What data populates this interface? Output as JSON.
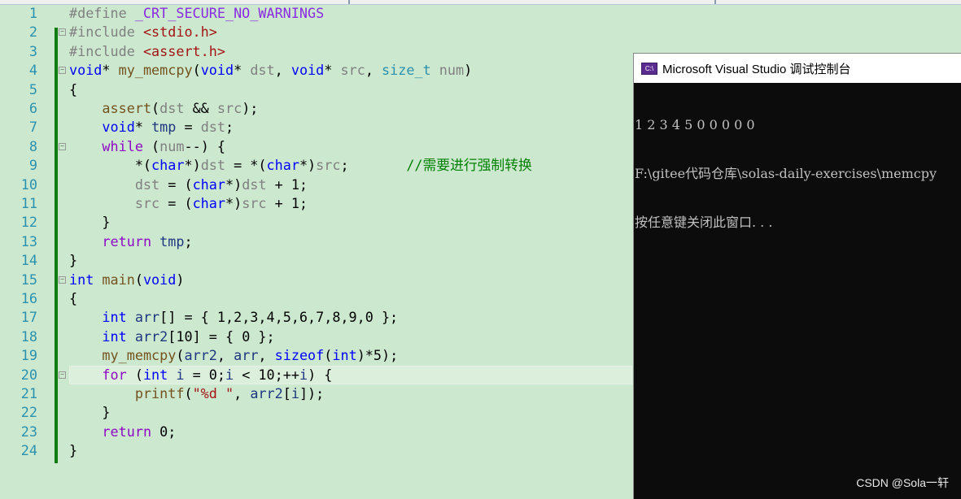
{
  "editor": {
    "current_line": 20,
    "lines": [
      [
        [
          "pp",
          "#define "
        ],
        [
          "mac",
          "_CRT_SECURE_NO_WARNINGS"
        ]
      ],
      [
        [
          "pp",
          "#include "
        ],
        [
          "str",
          "<stdio.h>"
        ]
      ],
      [
        [
          "pp",
          "#include "
        ],
        [
          "str",
          "<assert.h>"
        ]
      ],
      [
        [
          "kw",
          "void"
        ],
        [
          "pl",
          "* "
        ],
        [
          "fn",
          "my_memcpy"
        ],
        [
          "pl",
          "("
        ],
        [
          "kw",
          "void"
        ],
        [
          "pl",
          "* "
        ],
        [
          "par",
          "dst"
        ],
        [
          "pl",
          ", "
        ],
        [
          "kw",
          "void"
        ],
        [
          "pl",
          "* "
        ],
        [
          "par",
          "src"
        ],
        [
          "pl",
          ", "
        ],
        [
          "ty",
          "size_t"
        ],
        [
          "pl",
          " "
        ],
        [
          "par",
          "num"
        ],
        [
          "pl",
          ")"
        ]
      ],
      [
        [
          "pl",
          "{"
        ]
      ],
      [
        [
          "pl",
          "    "
        ],
        [
          "fn",
          "assert"
        ],
        [
          "pl",
          "("
        ],
        [
          "par",
          "dst"
        ],
        [
          "pl",
          " && "
        ],
        [
          "par",
          "src"
        ],
        [
          "pl",
          ");"
        ]
      ],
      [
        [
          "pl",
          "    "
        ],
        [
          "kw",
          "void"
        ],
        [
          "pl",
          "* "
        ],
        [
          "loc",
          "tmp"
        ],
        [
          "pl",
          " = "
        ],
        [
          "par",
          "dst"
        ],
        [
          "pl",
          ";"
        ]
      ],
      [
        [
          "pl",
          "    "
        ],
        [
          "ctl",
          "while"
        ],
        [
          "pl",
          " ("
        ],
        [
          "par",
          "num"
        ],
        [
          "pl",
          "--) {"
        ]
      ],
      [
        [
          "pl",
          "        *("
        ],
        [
          "kw",
          "char"
        ],
        [
          "pl",
          "*)"
        ],
        [
          "par",
          "dst"
        ],
        [
          "pl",
          " = *("
        ],
        [
          "kw",
          "char"
        ],
        [
          "pl",
          "*)"
        ],
        [
          "par",
          "src"
        ],
        [
          "pl",
          ";       "
        ],
        [
          "cmt",
          "//需要进行强制转换"
        ]
      ],
      [
        [
          "pl",
          "        "
        ],
        [
          "par",
          "dst"
        ],
        [
          "pl",
          " = ("
        ],
        [
          "kw",
          "char"
        ],
        [
          "pl",
          "*)"
        ],
        [
          "par",
          "dst"
        ],
        [
          "pl",
          " + 1;"
        ]
      ],
      [
        [
          "pl",
          "        "
        ],
        [
          "par",
          "src"
        ],
        [
          "pl",
          " = ("
        ],
        [
          "kw",
          "char"
        ],
        [
          "pl",
          "*)"
        ],
        [
          "par",
          "src"
        ],
        [
          "pl",
          " + 1;"
        ]
      ],
      [
        [
          "pl",
          "    }"
        ]
      ],
      [
        [
          "pl",
          "    "
        ],
        [
          "ctl",
          "return"
        ],
        [
          "pl",
          " "
        ],
        [
          "loc",
          "tmp"
        ],
        [
          "pl",
          ";"
        ]
      ],
      [
        [
          "pl",
          "}"
        ]
      ],
      [
        [
          "kw",
          "int"
        ],
        [
          "pl",
          " "
        ],
        [
          "fn",
          "main"
        ],
        [
          "pl",
          "("
        ],
        [
          "kw",
          "void"
        ],
        [
          "pl",
          ")"
        ]
      ],
      [
        [
          "pl",
          "{"
        ]
      ],
      [
        [
          "pl",
          "    "
        ],
        [
          "kw",
          "int"
        ],
        [
          "pl",
          " "
        ],
        [
          "loc",
          "arr"
        ],
        [
          "pl",
          "[] = { 1,2,3,4,5,6,7,8,9,0 };"
        ]
      ],
      [
        [
          "pl",
          "    "
        ],
        [
          "kw",
          "int"
        ],
        [
          "pl",
          " "
        ],
        [
          "loc",
          "arr2"
        ],
        [
          "pl",
          "[10] = { 0 };"
        ]
      ],
      [
        [
          "pl",
          "    "
        ],
        [
          "fn",
          "my_memcpy"
        ],
        [
          "pl",
          "("
        ],
        [
          "loc",
          "arr2"
        ],
        [
          "pl",
          ", "
        ],
        [
          "loc",
          "arr"
        ],
        [
          "pl",
          ", "
        ],
        [
          "kw",
          "sizeof"
        ],
        [
          "pl",
          "("
        ],
        [
          "kw",
          "int"
        ],
        [
          "pl",
          ")*5);"
        ]
      ],
      [
        [
          "pl",
          "    "
        ],
        [
          "ctl",
          "for"
        ],
        [
          "pl",
          " ("
        ],
        [
          "kw",
          "int"
        ],
        [
          "pl",
          " "
        ],
        [
          "loc",
          "i"
        ],
        [
          "pl",
          " = 0;"
        ],
        [
          "loc",
          "i"
        ],
        [
          "pl",
          " < 10;++"
        ],
        [
          "loc",
          "i"
        ],
        [
          "pl",
          ") {"
        ]
      ],
      [
        [
          "pl",
          "        "
        ],
        [
          "fn",
          "printf"
        ],
        [
          "pl",
          "("
        ],
        [
          "str",
          "\"%d \""
        ],
        [
          "pl",
          ", "
        ],
        [
          "loc",
          "arr2"
        ],
        [
          "pl",
          "["
        ],
        [
          "loc",
          "i"
        ],
        [
          "pl",
          "]);"
        ]
      ],
      [
        [
          "pl",
          "    }"
        ]
      ],
      [
        [
          "pl",
          "    "
        ],
        [
          "ctl",
          "return"
        ],
        [
          "pl",
          " 0;"
        ]
      ],
      [
        [
          "pl",
          "}"
        ]
      ]
    ],
    "fold_lines": [
      2,
      4,
      8,
      15,
      20
    ]
  },
  "console": {
    "icon_text": "C:\\",
    "title": "Microsoft Visual Studio 调试控制台",
    "output": [
      "1 2 3 4 5 0 0 0 0 0",
      "F:\\gitee代码仓库\\solas-daily-exercises\\memcpy",
      "按任意键关闭此窗口. . ."
    ]
  },
  "watermark": "CSDN @Sola一轩"
}
